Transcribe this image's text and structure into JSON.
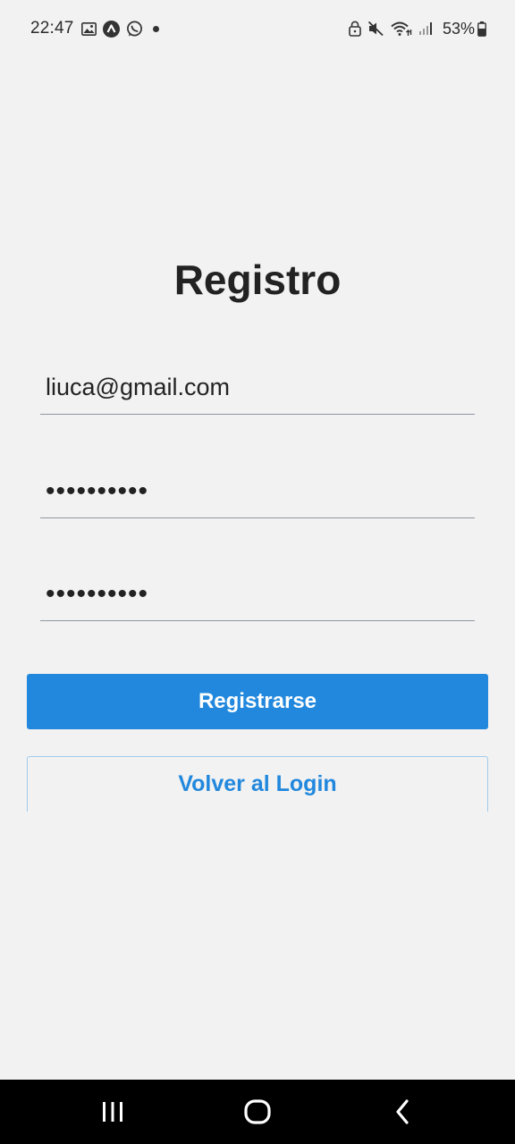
{
  "status_bar": {
    "time": "22:47",
    "battery": "53%",
    "icons_left": [
      "gallery-icon",
      "app-icon",
      "whatsapp-icon",
      "notification-dot"
    ],
    "icons_right": [
      "lock-icon",
      "mute-icon",
      "wifi-icon",
      "signal-icon",
      "battery-icon"
    ]
  },
  "page": {
    "title": "Registro"
  },
  "form": {
    "email_value": "liuca@gmail.com",
    "password_value": "••••••••••",
    "confirm_password_value": "••••••••••"
  },
  "buttons": {
    "register_label": "Registrarse",
    "back_to_login_label": "Volver al Login"
  },
  "colors": {
    "background": "#f2f2f2",
    "primary": "#2288dd",
    "title": "#222222",
    "underline": "#8c97a3"
  },
  "nav_bar": {
    "icons": [
      "recent-apps-icon",
      "home-icon",
      "back-icon"
    ]
  }
}
